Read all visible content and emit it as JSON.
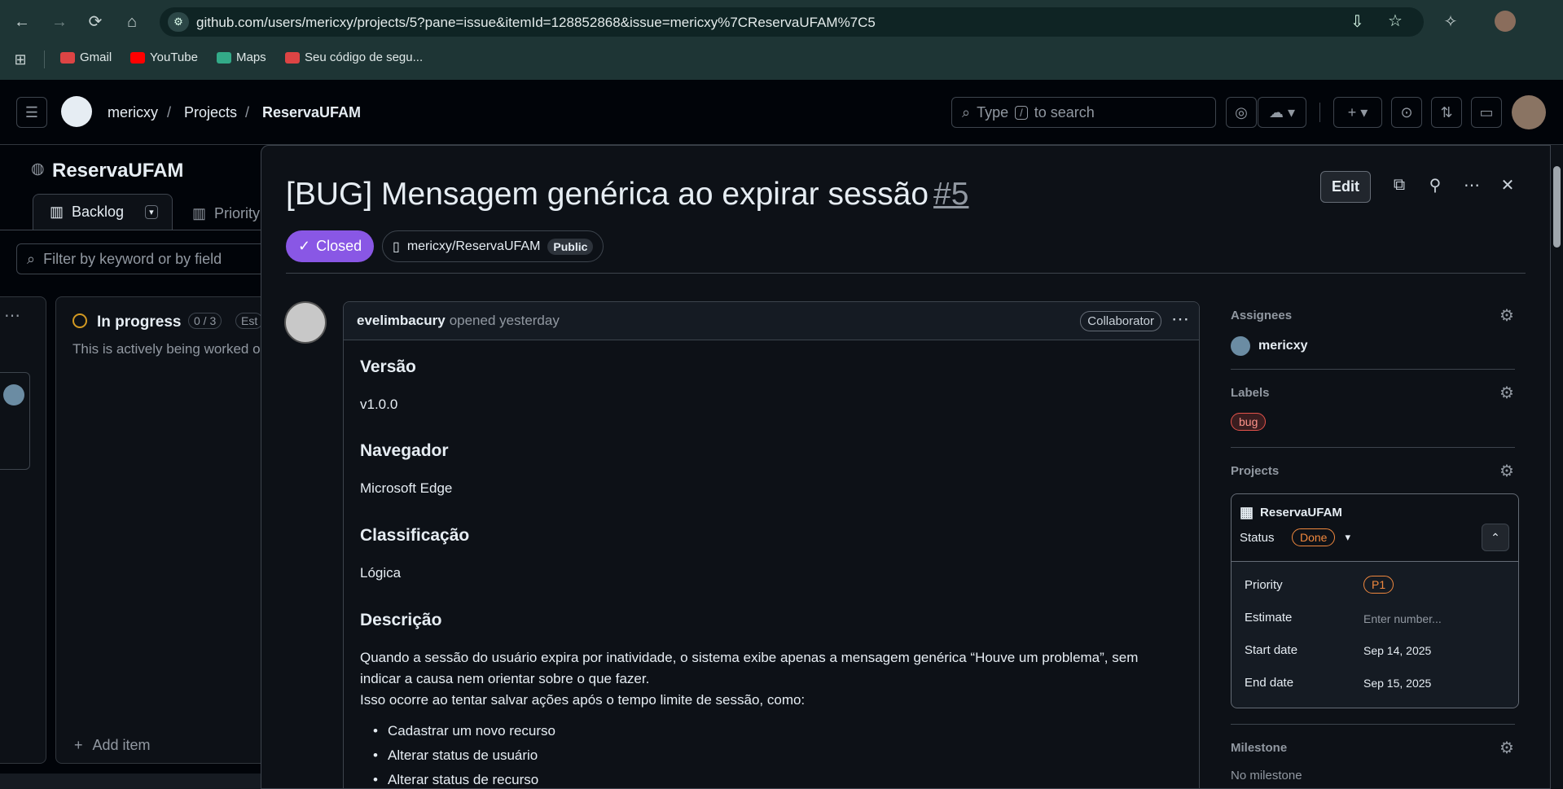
{
  "browser": {
    "url": "github.com/users/mericxy/projects/5?pane=issue&itemId=128852868&issue=mericxy%7CReservaUFAM%7C5",
    "bookmarks": [
      "Gmail",
      "YouTube",
      "Maps",
      "Seu código de segu..."
    ]
  },
  "header": {
    "breadcrumb": [
      "mericxy",
      "/",
      "Projects",
      "/",
      "ReservaUFAM"
    ],
    "search_placeholder_prefix": "Type",
    "search_key": "/",
    "search_placeholder_suffix": "to search"
  },
  "board": {
    "project_title": "ReservaUFAM",
    "views": [
      "Backlog",
      "Priority"
    ],
    "filter_placeholder": "Filter by keyword or by field",
    "column": {
      "name": "In progress",
      "count": "0 / 3",
      "estimate": "Est",
      "description": "This is actively being worked o",
      "add_item": "Add item"
    }
  },
  "issue": {
    "title": "[BUG] Mensagem genérica ao expirar sessão",
    "number": "#5",
    "state": "Closed",
    "repo": "mericxy/ReservaUFAM",
    "visibility": "Public",
    "edit_label": "Edit",
    "comment": {
      "author": "evelimbacury",
      "action": "opened yesterday",
      "role": "Collaborator",
      "sections": [
        {
          "heading": "Versão",
          "text": "v1.0.0"
        },
        {
          "heading": "Navegador",
          "text": "Microsoft Edge"
        },
        {
          "heading": "Classificação",
          "text": "Lógica"
        },
        {
          "heading": "Descrição",
          "text": ""
        }
      ],
      "description_lines": [
        "Quando a sessão do usuário expira por inatividade, o sistema exibe apenas a mensagem genérica “Houve um problema”, sem",
        "indicar a causa nem orientar sobre o que fazer.",
        "Isso ocorre ao tentar salvar ações após o tempo limite de sessão, como:"
      ],
      "bullets": [
        "Cadastrar um novo recurso",
        "Alterar status de usuário",
        "Alterar status de recurso"
      ]
    }
  },
  "sidebar": {
    "assignees_label": "Assignees",
    "assignee": "mericxy",
    "labels_label": "Labels",
    "label_bug": "bug",
    "projects_label": "Projects",
    "project": {
      "name": "ReservaUFAM",
      "status_label": "Status",
      "status_value": "Done",
      "fields": [
        {
          "label": "Priority",
          "value": "P1"
        },
        {
          "label": "Estimate",
          "value": "Enter number..."
        },
        {
          "label": "Start date",
          "value": "Sep 14, 2025"
        },
        {
          "label": "End date",
          "value": "Sep 15, 2025"
        }
      ]
    },
    "milestone_label": "Milestone",
    "milestone_value": "No milestone"
  },
  "colors": {
    "closed": "#8957e5",
    "done": "#f0883e",
    "bug": "#e5534b"
  }
}
